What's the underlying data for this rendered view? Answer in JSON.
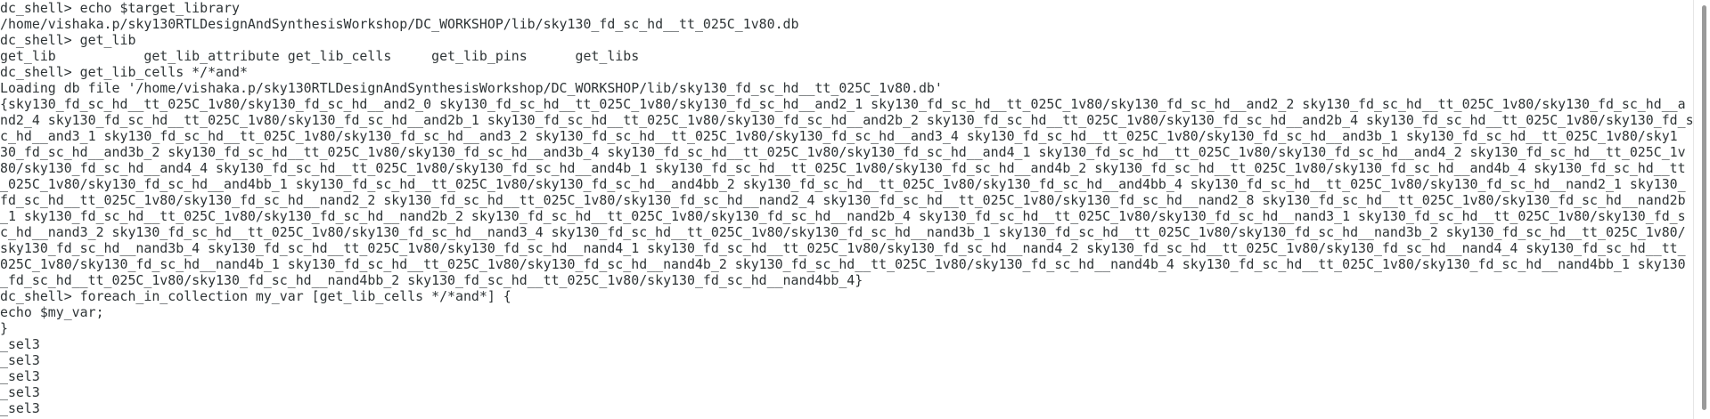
{
  "terminal": {
    "lines": [
      "dc_shell> echo $target_library",
      "/home/vishaka.p/sky130RTLDesignAndSynthesisWorkshop/DC_WORKSHOP/lib/sky130_fd_sc_hd__tt_025C_1v80.db",
      "dc_shell> get_lib",
      "get_lib           get_lib_attribute get_lib_cells     get_lib_pins      get_libs",
      "dc_shell> get_lib_cells */*and*",
      "Loading db file '/home/vishaka.p/sky130RTLDesignAndSynthesisWorkshop/DC_WORKSHOP/lib/sky130_fd_sc_hd__tt_025C_1v80.db'",
      "{sky130_fd_sc_hd__tt_025C_1v80/sky130_fd_sc_hd__and2_0 sky130_fd_sc_hd__tt_025C_1v80/sky130_fd_sc_hd__and2_1 sky130_fd_sc_hd__tt_025C_1v80/sky130_fd_sc_hd__and2_2 sky130_fd_sc_hd__tt_025C_1v80/sky130_fd_sc_hd__a",
      "nd2_4 sky130_fd_sc_hd__tt_025C_1v80/sky130_fd_sc_hd__and2b_1 sky130_fd_sc_hd__tt_025C_1v80/sky130_fd_sc_hd__and2b_2 sky130_fd_sc_hd__tt_025C_1v80/sky130_fd_sc_hd__and2b_4 sky130_fd_sc_hd__tt_025C_1v80/sky130_fd_s",
      "c_hd__and3_1 sky130_fd_sc_hd__tt_025C_1v80/sky130_fd_sc_hd__and3_2 sky130_fd_sc_hd__tt_025C_1v80/sky130_fd_sc_hd__and3_4 sky130_fd_sc_hd__tt_025C_1v80/sky130_fd_sc_hd__and3b_1 sky130_fd_sc_hd__tt_025C_1v80/sky1",
      "30_fd_sc_hd__and3b_2 sky130_fd_sc_hd__tt_025C_1v80/sky130_fd_sc_hd__and3b_4 sky130_fd_sc_hd__tt_025C_1v80/sky130_fd_sc_hd__and4_1 sky130_fd_sc_hd__tt_025C_1v80/sky130_fd_sc_hd__and4_2 sky130_fd_sc_hd__tt_025C_1v",
      "80/sky130_fd_sc_hd__and4_4 sky130_fd_sc_hd__tt_025C_1v80/sky130_fd_sc_hd__and4b_1 sky130_fd_sc_hd__tt_025C_1v80/sky130_fd_sc_hd__and4b_2 sky130_fd_sc_hd__tt_025C_1v80/sky130_fd_sc_hd__and4b_4 sky130_fd_sc_hd__tt",
      "_025C_1v80/sky130_fd_sc_hd__and4bb_1 sky130_fd_sc_hd__tt_025C_1v80/sky130_fd_sc_hd__and4bb_2 sky130_fd_sc_hd__tt_025C_1v80/sky130_fd_sc_hd__and4bb_4 sky130_fd_sc_hd__tt_025C_1v80/sky130_fd_sc_hd__nand2_1 sky130_",
      "fd_sc_hd__tt_025C_1v80/sky130_fd_sc_hd__nand2_2 sky130_fd_sc_hd__tt_025C_1v80/sky130_fd_sc_hd__nand2_4 sky130_fd_sc_hd__tt_025C_1v80/sky130_fd_sc_hd__nand2_8 sky130_fd_sc_hd__tt_025C_1v80/sky130_fd_sc_hd__nand2b",
      "_1 sky130_fd_sc_hd__tt_025C_1v80/sky130_fd_sc_hd__nand2b_2 sky130_fd_sc_hd__tt_025C_1v80/sky130_fd_sc_hd__nand2b_4 sky130_fd_sc_hd__tt_025C_1v80/sky130_fd_sc_hd__nand3_1 sky130_fd_sc_hd__tt_025C_1v80/sky130_fd_s",
      "c_hd__nand3_2 sky130_fd_sc_hd__tt_025C_1v80/sky130_fd_sc_hd__nand3_4 sky130_fd_sc_hd__tt_025C_1v80/sky130_fd_sc_hd__nand3b_1 sky130_fd_sc_hd__tt_025C_1v80/sky130_fd_sc_hd__nand3b_2 sky130_fd_sc_hd__tt_025C_1v80/",
      "sky130_fd_sc_hd__nand3b_4 sky130_fd_sc_hd__tt_025C_1v80/sky130_fd_sc_hd__nand4_1 sky130_fd_sc_hd__tt_025C_1v80/sky130_fd_sc_hd__nand4_2 sky130_fd_sc_hd__tt_025C_1v80/sky130_fd_sc_hd__nand4_4 sky130_fd_sc_hd__tt_",
      "025C_1v80/sky130_fd_sc_hd__nand4b_1 sky130_fd_sc_hd__tt_025C_1v80/sky130_fd_sc_hd__nand4b_2 sky130_fd_sc_hd__tt_025C_1v80/sky130_fd_sc_hd__nand4b_4 sky130_fd_sc_hd__tt_025C_1v80/sky130_fd_sc_hd__nand4bb_1 sky130",
      "_fd_sc_hd__tt_025C_1v80/sky130_fd_sc_hd__nand4bb_2 sky130_fd_sc_hd__tt_025C_1v80/sky130_fd_sc_hd__nand4bb_4}",
      "dc_shell> foreach_in_collection my_var [get_lib_cells */*and*] {",
      "echo $my_var;",
      "}",
      "_sel3",
      "_sel3",
      "_sel3",
      "_sel3",
      "_sel3"
    ]
  },
  "colors": {
    "background": "#ffffff",
    "text": "#2e3436",
    "scrollbar_thumb": "#9a9a9a"
  }
}
